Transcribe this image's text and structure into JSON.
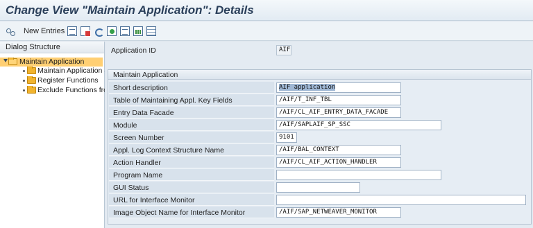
{
  "title": "Change View \"Maintain Application\": Details",
  "toolbar": {
    "new_entries_label": "New Entries",
    "icons": [
      "glasses-icon",
      "copy-icon",
      "delete-icon",
      "undo-icon",
      "select-icon",
      "detail-icon",
      "chart-icon",
      "table-icon"
    ]
  },
  "dialog_structure": {
    "header": "Dialog Structure",
    "items": [
      {
        "label": "Maintain Application",
        "selected": true,
        "expanded": true
      },
      {
        "label": "Maintain Application S",
        "selected": false
      },
      {
        "label": "Register Functions",
        "selected": false
      },
      {
        "label": "Exclude Functions fro",
        "selected": false
      }
    ]
  },
  "application_id": {
    "label": "Application ID",
    "value": "AIF"
  },
  "group": {
    "title": "Maintain Application",
    "fields": [
      {
        "label": "Short description",
        "value": "AIF application"
      },
      {
        "label": "Table of Maintaining Appl. Key Fields",
        "value": "/AIF/T_INF_TBL"
      },
      {
        "label": "Entry Data Facade",
        "value": "/AIF/CL_AIF_ENTRY_DATA_FACADE"
      },
      {
        "label": "Module",
        "value": "/AIF/SAPLAIF_SP_SSC"
      },
      {
        "label": "Screen Number",
        "value": "9101"
      },
      {
        "label": "Appl. Log Context Structure Name",
        "value": "/AIF/BAL_CONTEXT"
      },
      {
        "label": "Action Handler",
        "value": "/AIF/CL_AIF_ACTION_HANDLER"
      },
      {
        "label": "Program Name",
        "value": ""
      },
      {
        "label": "GUI Status",
        "value": ""
      },
      {
        "label": "URL for Interface Monitor",
        "value": ""
      },
      {
        "label": "Image Object Name for Interface Monitor",
        "value": "/AIF/SAP_NETWEAVER_MONITOR"
      }
    ]
  },
  "colors": {
    "selection": "#ffcf73",
    "title": "#2a3f5a",
    "background": "#e4ebf2"
  }
}
